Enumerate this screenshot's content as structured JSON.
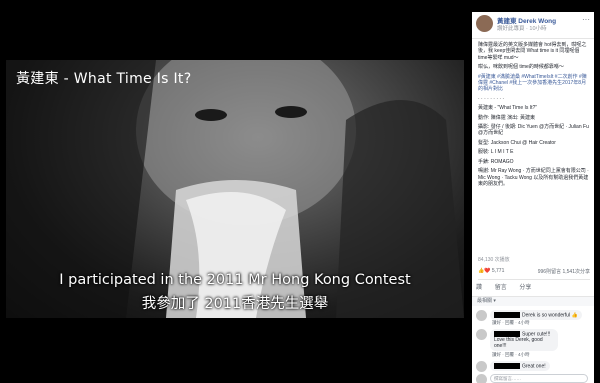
{
  "video": {
    "title": "黃建東 - What Time Is It?",
    "subtitle_en": "I participated in the 2011 Mr Hong Kong Contest",
    "subtitle_zh": "我參加了 2011香港先生選舉"
  },
  "post": {
    "page_name": "黃建東 Derek Wong",
    "page_sub": "讚好此專頁 · 10小時",
    "more": "···",
    "paragraphs": [
      "陳偉霆最近的英文版多媒體會 hot得去到，咁呢之後，我 keep佳閑去問 What time is it 同埋呢個 time等緊咩 mud～",
      "咁仏，咪飲到呢個 time的時候都靠喺～",
      "#黃建東 #滿臉滄桑 #WhatTimeIsIt #二次創作 #陳偉霆 #Chanel #我上一次參加香港先生2017年8月的相片對比"
    ],
    "song_line": "黃建東 - \"What Time Is It?\"",
    "credits": [
      "動作: 陳偉霆 演出: 黃建東",
      "攝影: 發仔 / 後期: Dic Yuen @方而世紀 · Julian Fu @方而世紀",
      "髮型: Jackson Chui @ Hair Creator",
      "服裝: L I M I T E",
      "手錶: ROMAGO",
      "鳴謝: Mr Ray Wong · 方而世紀同上黨會有限公司 · Mic Wong · Tacku Wong 以及所有幫助過我們黃建東的朋友們。"
    ],
    "views": "84,130 次播放",
    "reactions": "5,771",
    "comments_shares": "996則留言 1,541次分享",
    "actions": [
      "讚",
      "留言",
      "分享"
    ],
    "sort": "最相關 ▾"
  },
  "comments": [
    {
      "text": "Derek is so wonderful 👍",
      "meta": "讚好 · 回覆 · 4小時"
    },
    {
      "text": "Super cute!!! Love this Derek, good one!!!",
      "meta": "讚好 · 回覆 · 4小時"
    },
    {
      "text": "Great one!",
      "meta": ""
    }
  ],
  "write_placeholder": "撰寫留言……"
}
